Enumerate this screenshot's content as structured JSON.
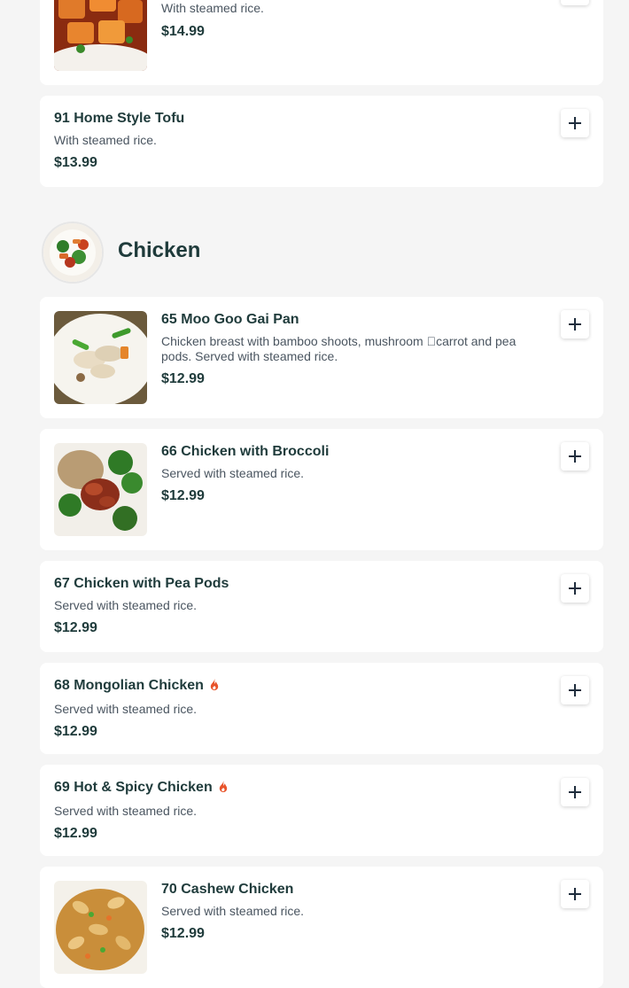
{
  "prev_item": {
    "desc": "With steamed rice.",
    "price": "$14.99"
  },
  "items_top": [
    {
      "name": "91 Home Style Tofu",
      "desc": "With steamed rice.",
      "price": "$13.99"
    }
  ],
  "section": {
    "title": "Chicken"
  },
  "items": [
    {
      "name": "65 Moo Goo Gai Pan",
      "desc": "Chicken breast with bamboo shoots, mushroom \u0000carrot and pea pods. Served with steamed rice.",
      "price": "$12.99"
    },
    {
      "name": "66 Chicken with Broccoli",
      "desc": "Served with steamed rice.",
      "price": "$12.99"
    },
    {
      "name": "67 Chicken with Pea Pods",
      "desc": "Served with steamed rice.",
      "price": "$12.99"
    },
    {
      "name": "68 Mongolian Chicken",
      "desc": "Served with steamed rice.",
      "price": "$12.99"
    },
    {
      "name": "69 Hot & Spicy Chicken",
      "desc": "Served with steamed rice.",
      "price": "$12.99"
    },
    {
      "name": "70 Cashew Chicken",
      "desc": "Served with steamed rice.",
      "price": "$12.99"
    }
  ],
  "icons": {
    "add": "plus-icon",
    "spicy": "flame-icon"
  },
  "colors": {
    "spicy": "#e8542b",
    "text": "#1f3b3b"
  }
}
